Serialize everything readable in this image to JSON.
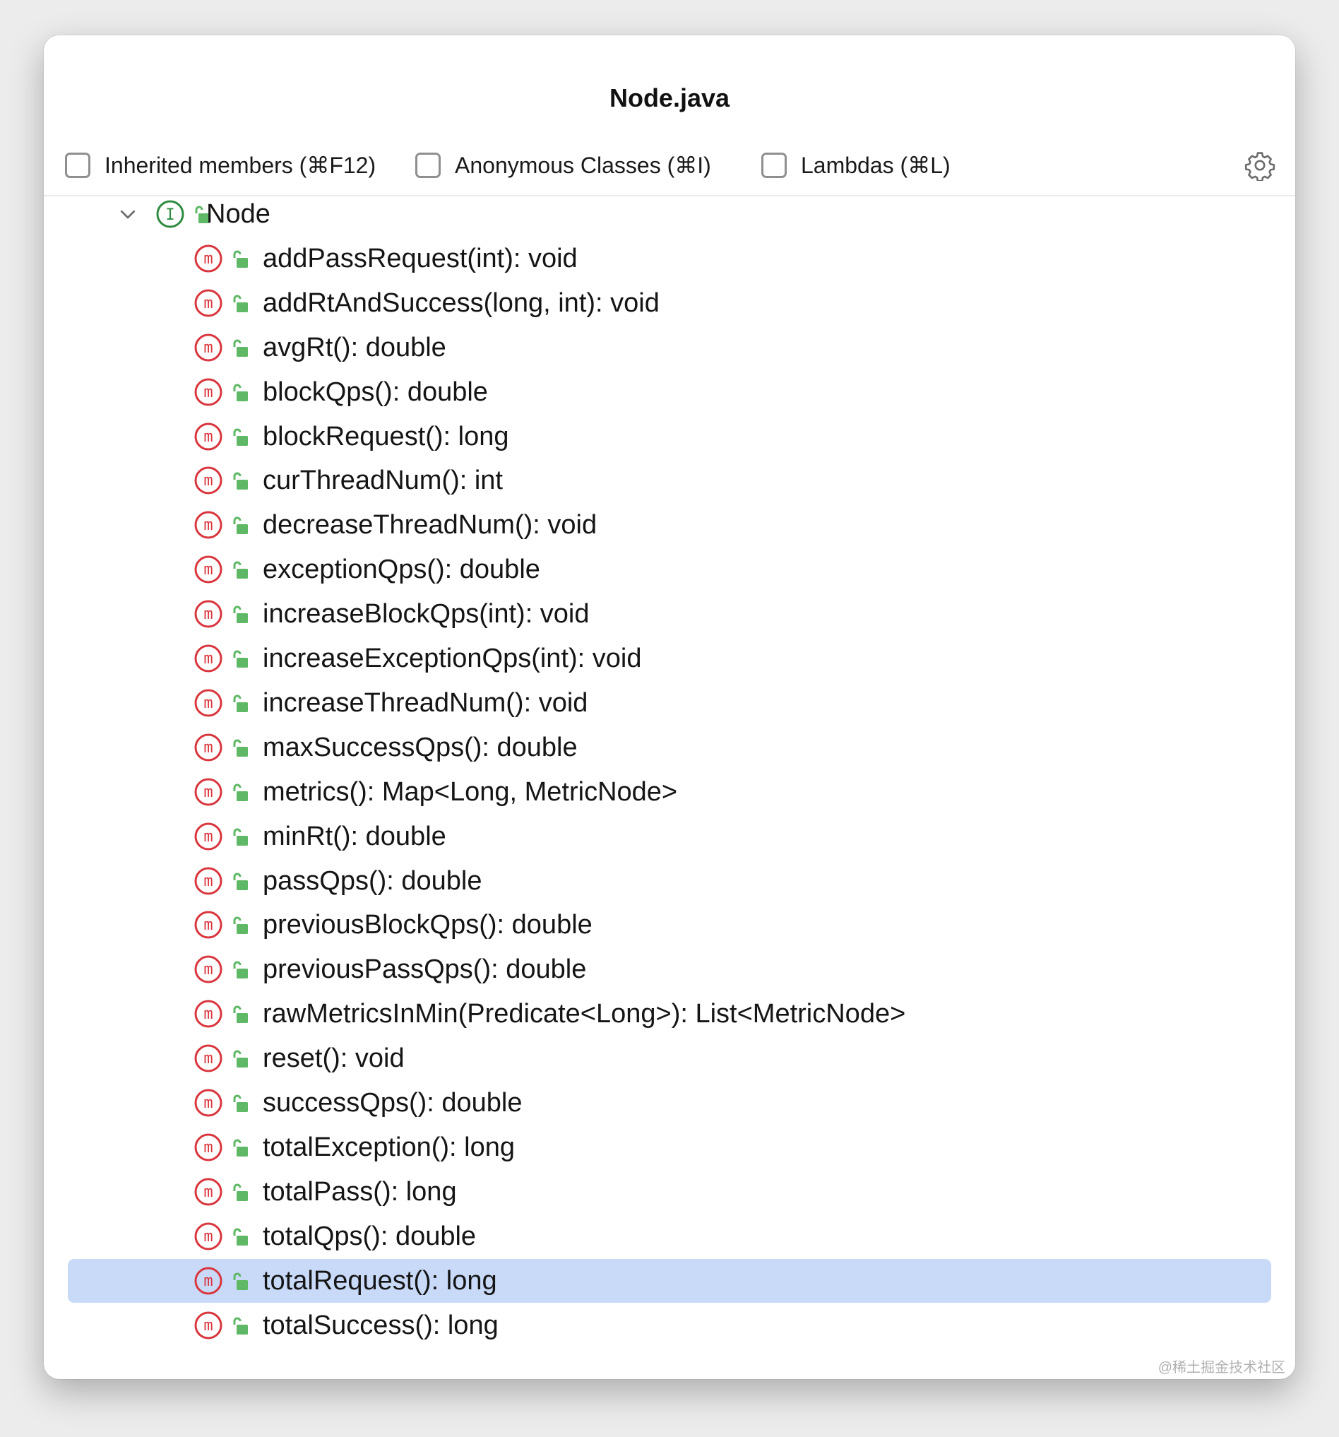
{
  "window": {
    "title": "Node.java"
  },
  "filters": [
    {
      "label": "Inherited members (⌘F12)",
      "checked": false
    },
    {
      "label": "Anonymous Classes (⌘I)",
      "checked": false
    },
    {
      "label": "Lambdas (⌘L)",
      "checked": false
    }
  ],
  "settings_icon": "gear-icon",
  "tree": {
    "root": {
      "label": "Node",
      "kind": "interface",
      "icon_letter": "I",
      "expanded": true
    },
    "method_icon_letter": "m",
    "members": [
      "addPassRequest(int): void",
      "addRtAndSuccess(long, int): void",
      "avgRt(): double",
      "blockQps(): double",
      "blockRequest(): long",
      "curThreadNum(): int",
      "decreaseThreadNum(): void",
      "exceptionQps(): double",
      "increaseBlockQps(int): void",
      "increaseExceptionQps(int): void",
      "increaseThreadNum(): void",
      "maxSuccessQps(): double",
      "metrics(): Map<Long, MetricNode>",
      "minRt(): double",
      "passQps(): double",
      "previousBlockQps(): double",
      "previousPassQps(): double",
      "rawMetricsInMin(Predicate<Long>): List<MetricNode>",
      "reset(): void",
      "successQps(): double",
      "totalException(): long",
      "totalPass(): long",
      "totalQps(): double",
      "totalRequest(): long",
      "totalSuccess(): long"
    ],
    "selected_member": "totalRequest(): long"
  },
  "colors": {
    "selection": "#c9daf9",
    "method_icon": "#d9363e",
    "interface_icon": "#2e8b3f",
    "lock_icon": "#5fb865"
  },
  "watermark": "@稀土掘金技术社区"
}
